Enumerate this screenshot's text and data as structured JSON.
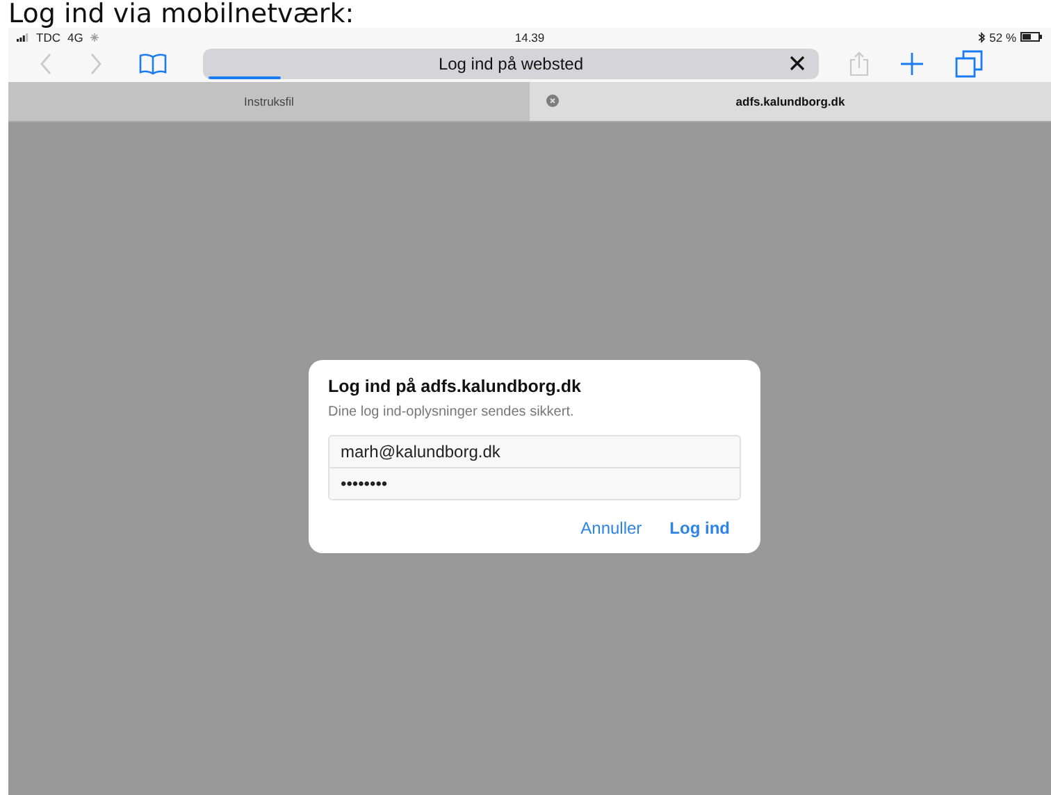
{
  "heading": "Log ind via mobilnetværk:",
  "status_bar": {
    "carrier": "TDC",
    "network": "4G",
    "time": "14.39",
    "battery": "52 %"
  },
  "toolbar": {
    "left_buttons": [
      {
        "kind": "back",
        "disabled": true
      },
      {
        "kind": "forward",
        "disabled": true
      },
      {
        "kind": "bookmarks",
        "disabled": false
      }
    ],
    "address_bar": {
      "title": "Log ind på websted",
      "level": 0.12
    },
    "right_buttons": [
      {
        "kind": "share",
        "disabled": true
      },
      {
        "kind": "new-tab",
        "disabled": false
      },
      {
        "kind": "tabs",
        "disabled": false
      }
    ]
  },
  "tabs": [
    {
      "label": "Instruksfil",
      "selected": false
    },
    {
      "label": "adfs.kalundborg.dk",
      "selected": true
    }
  ],
  "dialog": {
    "title": "Log ind på adfs.kalundborg.dk",
    "message": "Dine log ind-oplysninger sendes sikkert.",
    "username": "marh@kalundborg.dk",
    "password": "••••••••",
    "buttons": [
      {
        "label": "Annuller",
        "kind": "cancel"
      },
      {
        "label": "Log ind",
        "kind": "default"
      }
    ]
  }
}
